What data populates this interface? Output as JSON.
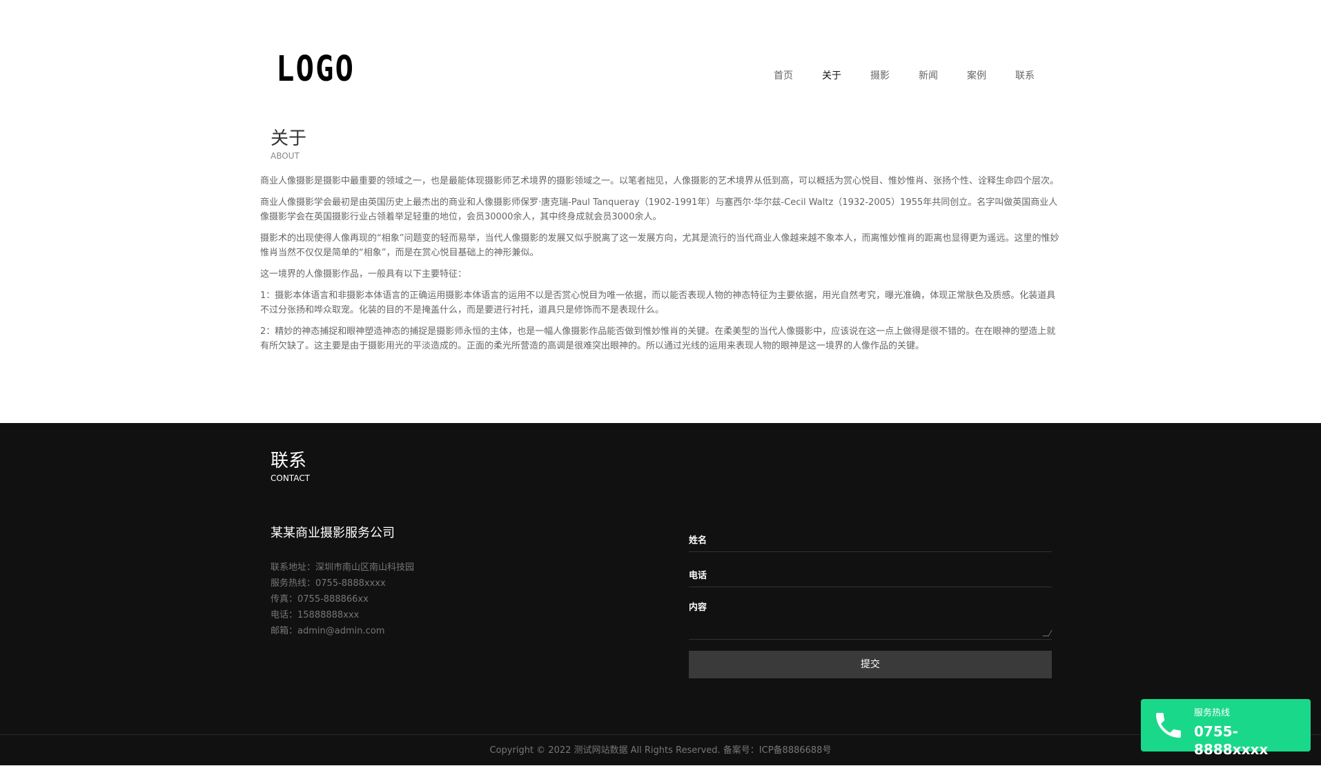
{
  "header": {
    "logo": "LOGO",
    "nav": [
      "首页",
      "关于",
      "摄影",
      "新闻",
      "案例",
      "联系"
    ],
    "active_nav": "关于"
  },
  "about": {
    "title": "关于",
    "subtitle": "ABOUT",
    "paragraphs": [
      "商业人像摄影是摄影中最重要的领域之一，也是最能体现摄影师艺术境界的摄影领域之一。以笔者拙见，人像摄影的艺术境界从低到高，可以概括为赏心悦目、惟妙惟肖、张扬个性、诠释生命四个层次。",
      "商业人像摄影学会最初是由英国历史上最杰出的商业和人像摄影师保罗·唐克瑞-Paul Tanqueray（1902-1991年）与塞西尔·华尔兹-Cecil Waltz（1932-2005）1955年共同创立。名字叫做英国商业人像摄影学会在英国摄影行业占领着举足轻重的地位，会员30000余人，其中终身成就会员3000余人。",
      "摄影术的出现使得人像再现的“相象”问题变的轻而易举，当代人像摄影的发展又似乎脱离了这一发展方向，尤其是流行的当代商业人像越来越不象本人，而离惟妙惟肖的距离也显得更为遥远。这里的惟妙惟肖当然不仅仅是简单的“相象”，而是在赏心悦目基础上的神形兼似。",
      "这一境界的人像摄影作品，一般具有以下主要特征：",
      "1：摄影本体语言和非摄影本体语言的正确运用摄影本体语言的运用不以是否赏心悦目为唯一依据，而以能否表现人物的神态特征为主要依据，用光自然考究，曝光准确，体现正常肤色及质感。化装道具不过分张扬和哗众取宠。化装的目的不是掩盖什么，而是要进行衬托，道具只是修饰而不是表现什么。",
      "2：精妙的神态捕捉和眼神塑造神态的捕捉是摄影师永恒的主体，也是一幅人像摄影作品能否做到惟妙惟肖的关键。在柔美型的当代人像摄影中，应该说在这一点上做得是很不错的。在在眼神的塑造上就有所欠缺了。这主要是由于摄影用光的平淡造成的。正面的柔光所营造的高调是很难突出眼神的。所以通过光线的运用来表现人物的眼神是这一境界的人像作品的关键。"
    ]
  },
  "contact": {
    "title": "联系",
    "subtitle": "CONTACT",
    "company": "某某商业摄影服务公司",
    "info": [
      "联系地址：深圳市南山区南山科技园",
      "服务热线：0755-8888xxxx",
      "传真：0755-888866xx",
      "电话：15888888xxx",
      "邮箱：admin@admin.com"
    ],
    "form": {
      "name_label": "姓名",
      "phone_label": "电话",
      "content_label": "内容",
      "submit_label": "提交"
    }
  },
  "footer": {
    "copyright": "Copyright © 2022 测试网站数据 All Rights Reserved.  备案号：ICP备8886688号"
  },
  "hotline": {
    "label": "服务热线",
    "number": "0755-8888xxxx",
    "color": "#19d88a",
    "icon": "phone-icon"
  }
}
